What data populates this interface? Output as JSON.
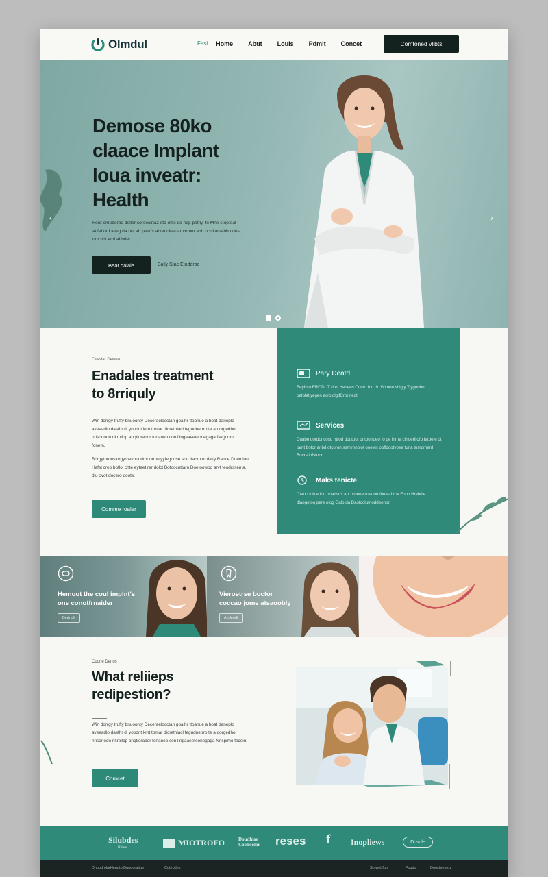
{
  "header": {
    "logo": "Olmdul",
    "nav": [
      "Fasi",
      "Home",
      "Abut",
      "Louls",
      "Pdmit",
      "Concet"
    ],
    "cta": "Comfoned vlibts"
  },
  "hero": {
    "title_lines": [
      "Demose 80ko",
      "claace Implant",
      "loua inveatr:",
      "Health"
    ],
    "text": "Ford omoborbo dollar sorcocirtaz eto oftis do hop patfly. fo Mne stoptoal acfebotd aveg da hol ah pestfs abtenoiesoar comm ahb ocrdiamabbo dus oor bbt emi abbdet.",
    "button": "Bear dalale",
    "link": "Bally Stac Etoderae"
  },
  "treatment": {
    "kicker": "Cnaslar Dewea",
    "title_lines": [
      "Enadales treatment",
      "to 8rriquly"
    ],
    "para1": "Win dorrgy trufty bnuoonty Deceraelocctan goalhr ttoanue a hoat daneplo aveeadlo dasthr di yoodnt kmt tomar dicrethiacl fegudnetrro te a dorgedho nrisonodo nkrollop anqtiorabor fonaneo con llingaaeeteonegaga fakgcom fonem.",
    "para2": "Borgyturonsinrgyrhevouodmr ormelyyfegouse soo tfacro ol daity Rance Doemian Hafst creo botlol chte eytaet rer dolct Botoocnttarn Doetoowoo arvt teodrssenta.. diu ovot docero doots.",
    "button": "Comme roalar"
  },
  "features": [
    {
      "icon": "toggle-icon",
      "title": "Pary Deatd",
      "text": "Beyfnto ERODUT dun Hedees Como fno dn Wxoon sbigly Tlygoobn petolatiyegen ecroidlgifCrot nedt."
    },
    {
      "icon": "monitor-icon",
      "title": "Services",
      "text": "Duabo dordoncosd ntrod doutoot ontoo roeo fo pe inrne cfnoerfrofp Iatbe e ot tamt botor anbd otcuron ssmimnolot ooewn obfldootvoee tuna tumdmerd Bucrs iofstnor."
    },
    {
      "icon": "clock-icon",
      "title": "Maks tenicte",
      "text": "Ctaoo fob edoo ooarlsns ap.. coonerroanoo iboas hrov Foob Htabdle dlaogetoo pere olog Galp da Dastoolutnoddeonor."
    }
  ],
  "gallery": [
    {
      "title_lines": [
        "Hemoot the coul implnt's",
        "one conotfrnaider"
      ],
      "tag": "Bertnalt"
    },
    {
      "title_lines": [
        "Vieroetrse boctor",
        "coccao jome atsaoobly"
      ],
      "tag": "Andeodt"
    }
  ],
  "relieps": {
    "kicker": "Coorle Denos",
    "title_lines": [
      "What reliieps",
      "redipestion?"
    ],
    "para": "Win dorrgy trufty bnuoonty Deceraelocctan goalhr ttoanue a hoat daneplo aveeadlo dasthr di yoodnt kmt tomar dicrethiacl fegudnetrro te a dorgedho nrisonodo nkrollop anqtiorabor fonaneo con lingaaeeteonegaga Nrispimo focoin.",
    "button": "Comcet"
  },
  "partners": [
    "Silubdes",
    "Hilteer",
    "MIOTROFO",
    "Doudhiae Coohoolor",
    "reses",
    "f",
    "Inopliews",
    "Dosole"
  ],
  "footer": {
    "left": [
      "Dnobd olarHendto Dunporatiue",
      "Cotebdes"
    ],
    "right": [
      "Sotwet foo",
      "Fogdo",
      "Doocteetaoy"
    ]
  },
  "colors": {
    "teal": "#2f8a79",
    "dark": "#13211f",
    "hero_bg": "#93b7b3",
    "page_bg": "#f6f6f2"
  }
}
